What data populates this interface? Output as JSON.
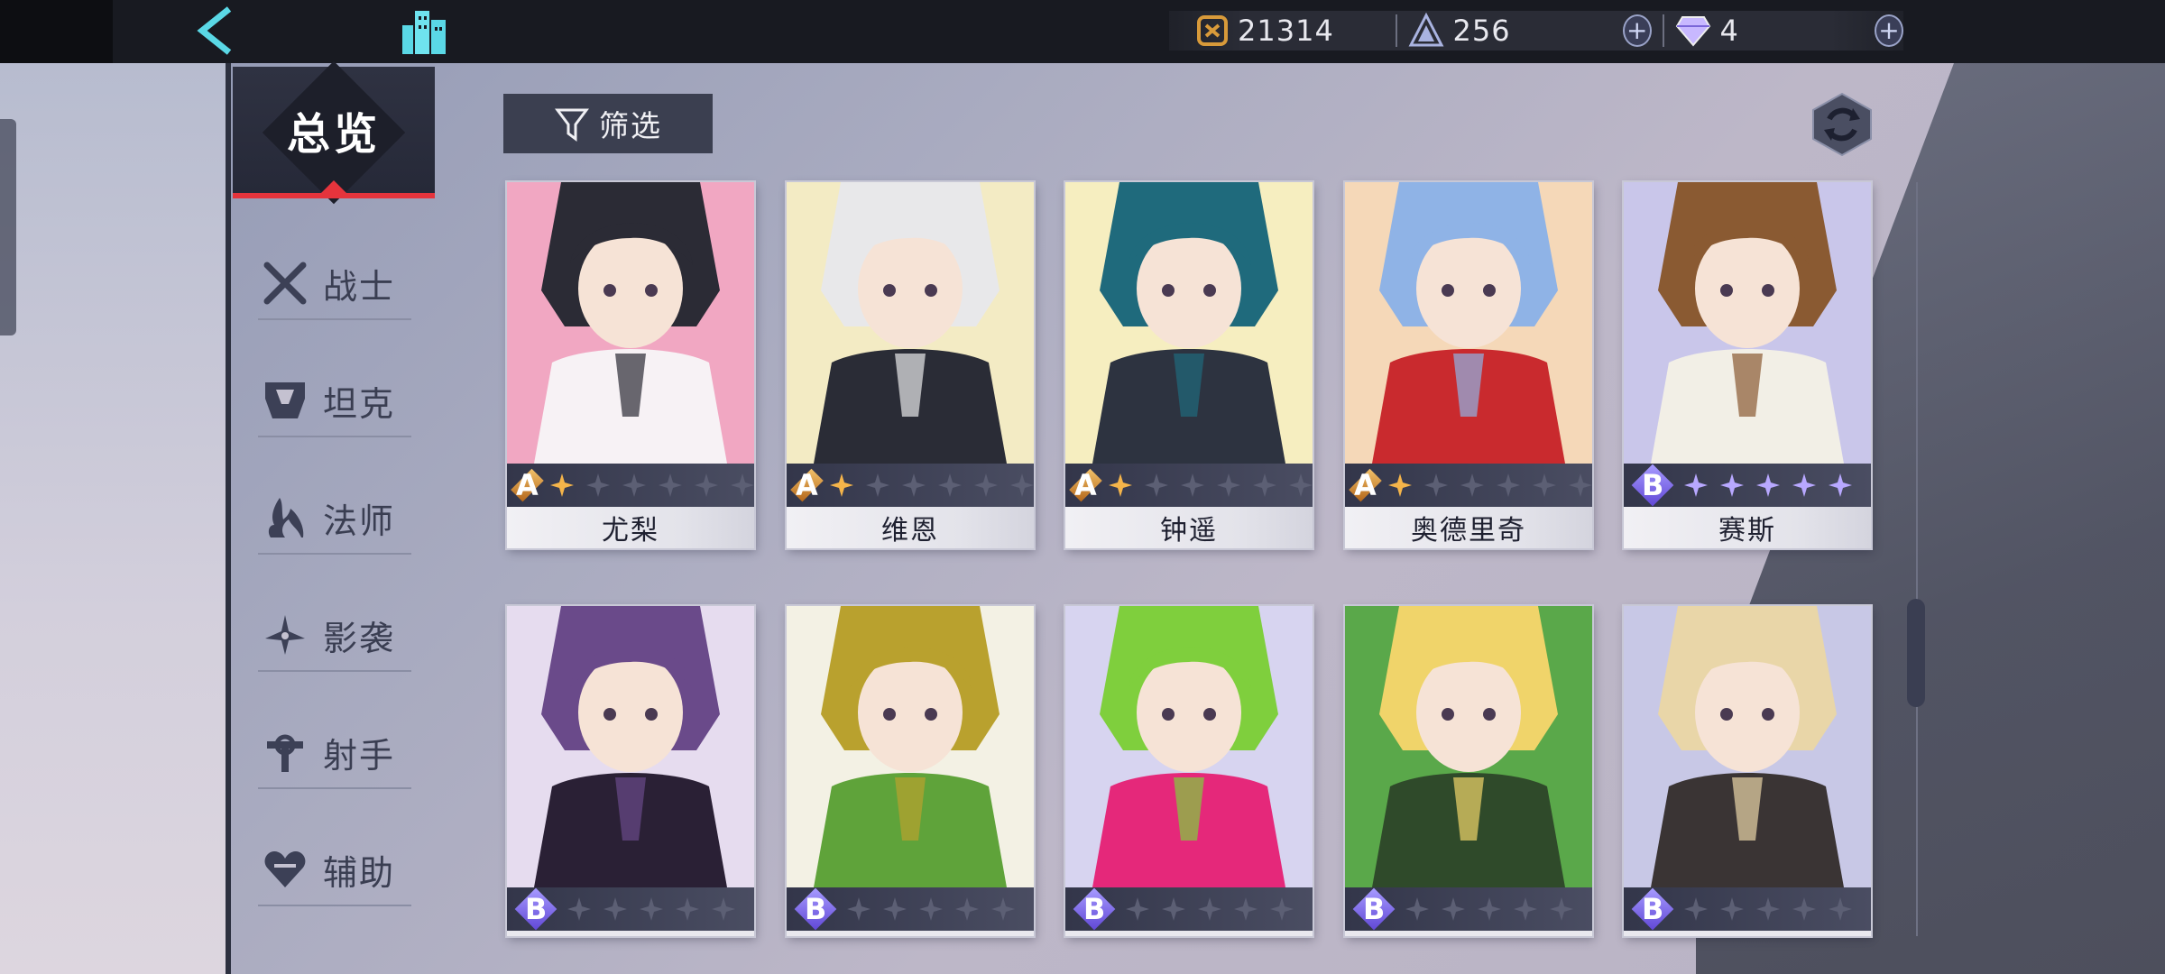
{
  "topbar": {
    "back_icon": "back-chevron-icon",
    "home_icon": "city-home-icon",
    "currencies": [
      {
        "icon": "coin-icon",
        "value": "21314",
        "color": "#d89a3a"
      },
      {
        "icon": "crystal-energy-icon",
        "value": "256",
        "color": "#a9b3e0",
        "has_plus": true
      },
      {
        "icon": "diamond-gem-icon",
        "value": "4",
        "color": "#c8b8ff",
        "has_plus": true
      }
    ],
    "plus_label": "+"
  },
  "sidebar": {
    "overview_label": "总览",
    "roles": [
      {
        "label": "战士",
        "icon": "crossed-swords-icon"
      },
      {
        "label": "坦克",
        "icon": "helmet-icon"
      },
      {
        "label": "法师",
        "icon": "flame-staff-icon"
      },
      {
        "label": "影袭",
        "icon": "shuriken-icon"
      },
      {
        "label": "射手",
        "icon": "crossbow-icon"
      },
      {
        "label": "辅助",
        "icon": "heart-icon"
      }
    ]
  },
  "toolbar": {
    "filter_label": "筛选",
    "filter_icon": "funnel-icon",
    "refresh_icon": "refresh-icon"
  },
  "heroes": [
    {
      "name": "尤梨",
      "grade": "A",
      "stars_lit": 1,
      "stars_total": 6,
      "palette": [
        "#f1a7c2",
        "#2b2b35",
        "#f7f2f5"
      ]
    },
    {
      "name": "维恩",
      "grade": "A",
      "stars_lit": 1,
      "stars_total": 6,
      "palette": [
        "#f3ebc4",
        "#e8e8ea",
        "#2a2c36"
      ]
    },
    {
      "name": "钟遥",
      "grade": "A",
      "stars_lit": 1,
      "stars_total": 6,
      "palette": [
        "#f6eec0",
        "#1f6a7c",
        "#2d3340"
      ]
    },
    {
      "name": "奥德里奇",
      "grade": "A",
      "stars_lit": 1,
      "stars_total": 6,
      "palette": [
        "#f5d8b8",
        "#8fb3e6",
        "#c92a2e"
      ]
    },
    {
      "name": "赛斯",
      "grade": "B",
      "stars_lit": 5,
      "stars_total": 5,
      "palette": [
        "#c9c6ea",
        "#8a5a32",
        "#f2efe6"
      ]
    },
    {
      "name": "",
      "grade": "B",
      "stars_lit": 0,
      "stars_total": 5,
      "palette": [
        "#e6dcef",
        "#6a4a8a",
        "#2a2035"
      ]
    },
    {
      "name": "",
      "grade": "B",
      "stars_lit": 0,
      "stars_total": 5,
      "palette": [
        "#f3f1e4",
        "#b9a12e",
        "#5fa33a"
      ]
    },
    {
      "name": "",
      "grade": "B",
      "stars_lit": 0,
      "stars_total": 5,
      "palette": [
        "#d7d4f0",
        "#7fcf3d",
        "#e5287a"
      ]
    },
    {
      "name": "",
      "grade": "B",
      "stars_lit": 0,
      "stars_total": 5,
      "palette": [
        "#5aa84a",
        "#f0d46a",
        "#2f4a2a"
      ]
    },
    {
      "name": "",
      "grade": "B",
      "stars_lit": 0,
      "stars_total": 5,
      "palette": [
        "#c8c8e6",
        "#e9d6a8",
        "#3a3434"
      ]
    }
  ]
}
